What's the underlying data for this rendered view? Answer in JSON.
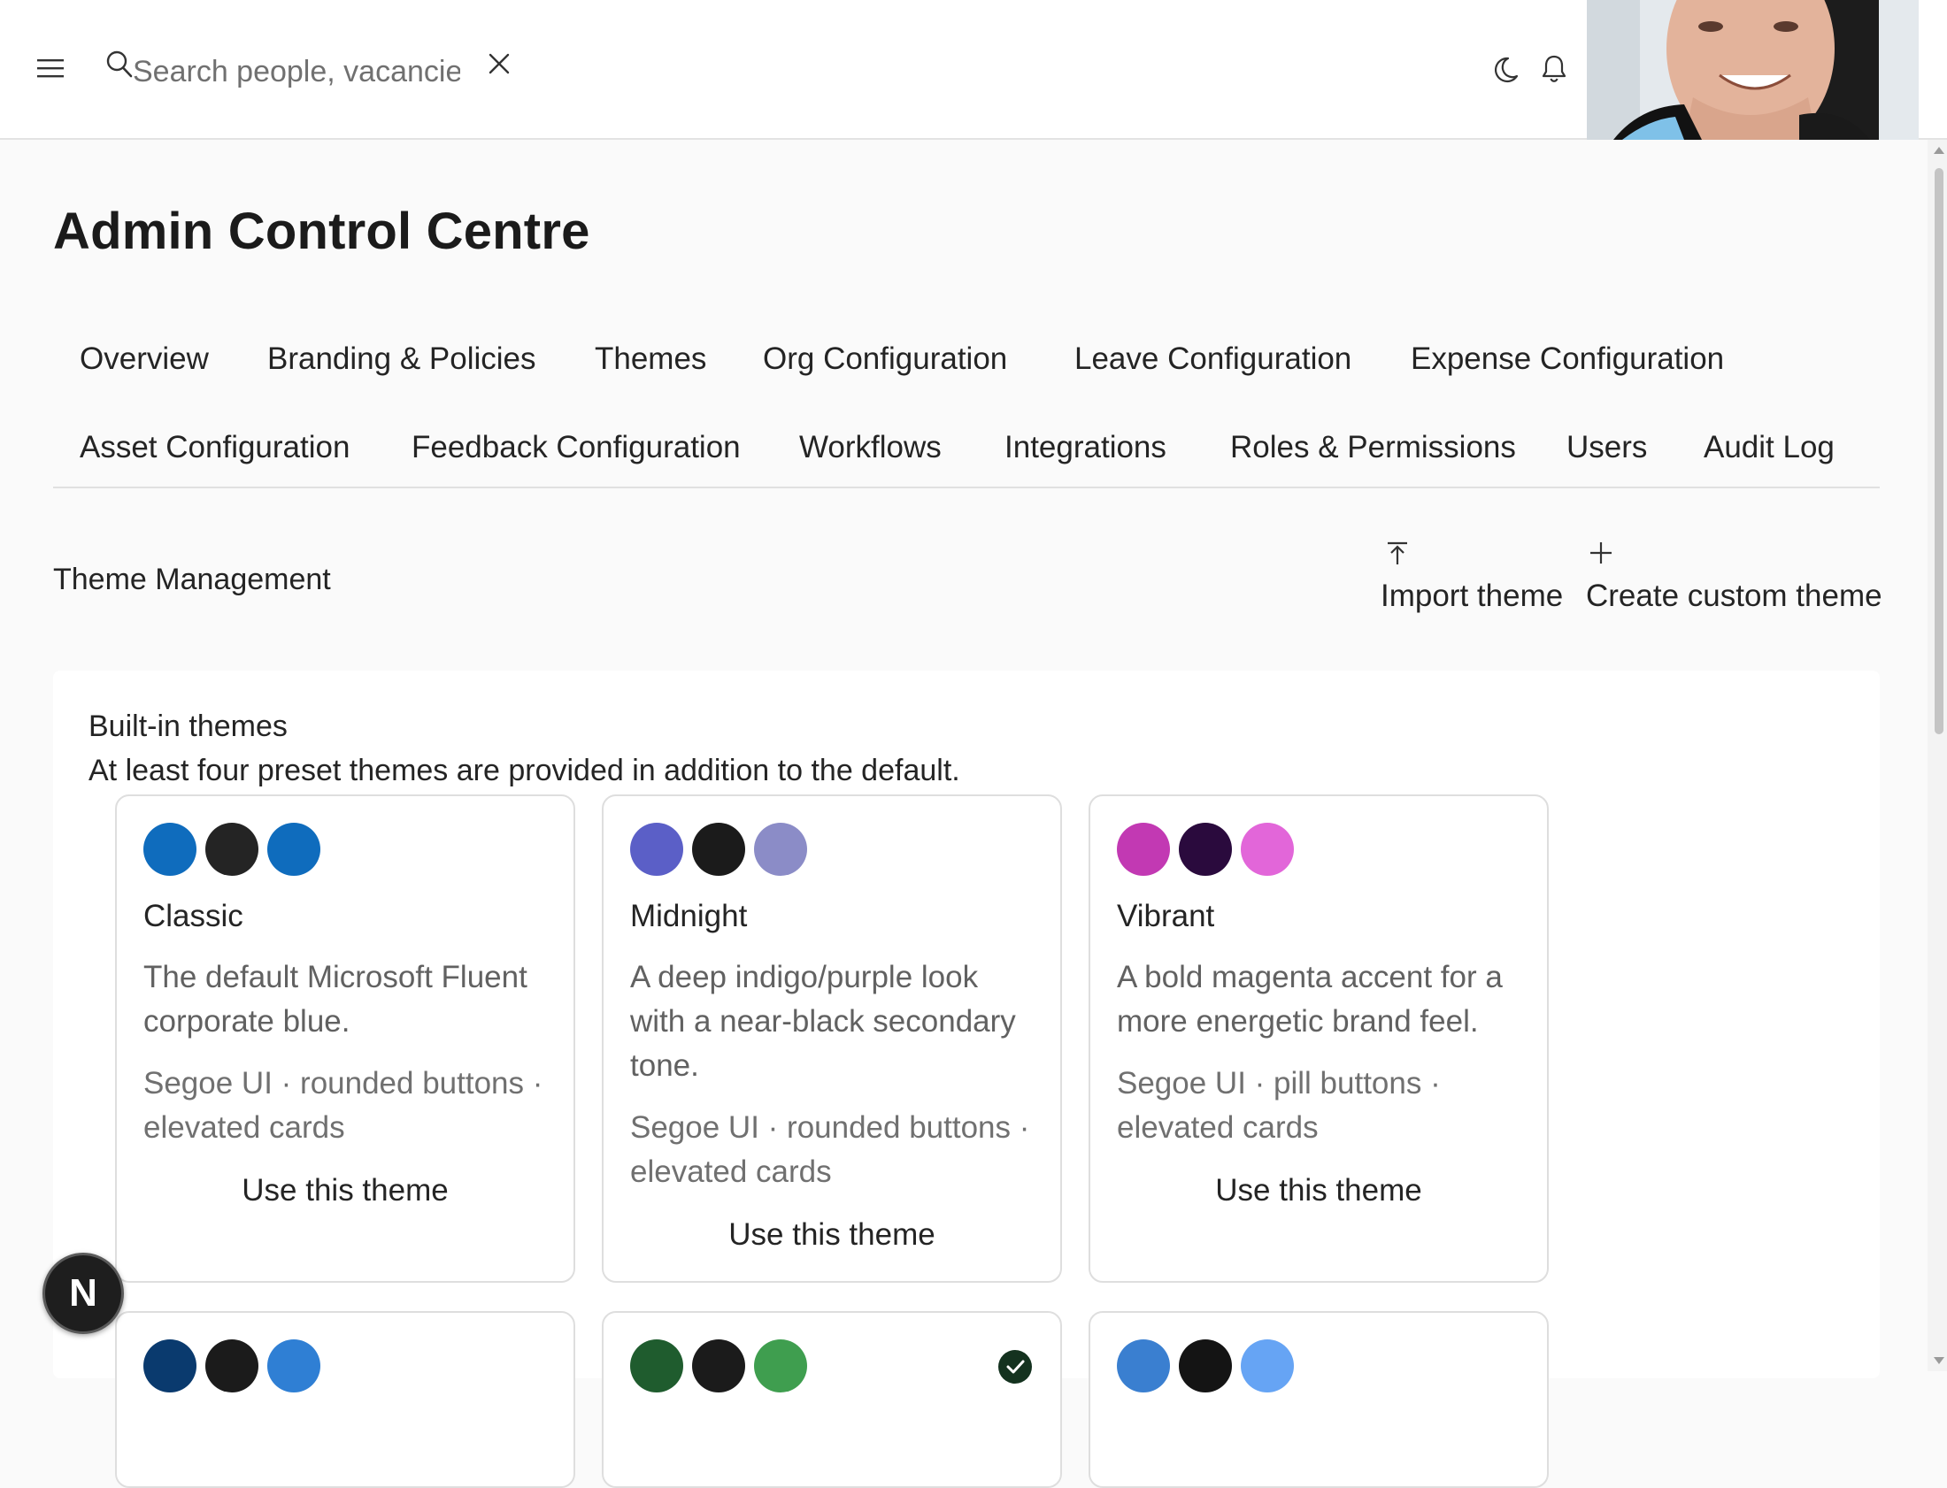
{
  "header": {
    "search": {
      "placeholder": "Search people, vacancies",
      "value": ""
    },
    "icons": [
      "hamburger-menu-icon",
      "search-icon",
      "close-icon",
      "moon-icon",
      "bell-icon"
    ]
  },
  "page": {
    "title": "Admin Control Centre"
  },
  "tabs": [
    {
      "label": "Overview"
    },
    {
      "label": "Branding & Policies"
    },
    {
      "label": "Themes"
    },
    {
      "label": "Org Configuration"
    },
    {
      "label": "Leave Configuration"
    },
    {
      "label": "Expense Configuration"
    },
    {
      "label": "Asset Configuration"
    },
    {
      "label": "Feedback Configuration"
    },
    {
      "label": "Workflows"
    },
    {
      "label": "Integrations"
    },
    {
      "label": "Roles & Permissions"
    },
    {
      "label": "Users"
    },
    {
      "label": "Audit Log"
    }
  ],
  "section": {
    "title": "Theme Management",
    "import_label": "Import theme",
    "create_label": "Create custom theme"
  },
  "builtin": {
    "title": "Built-in themes",
    "subtitle": "At least four preset themes are provided in addition to the default.",
    "themes": [
      {
        "name": "Classic",
        "description": "The default Microsoft Fluent corporate blue.",
        "meta": "Segoe UI · rounded buttons · elevated cards",
        "button": "Use this theme",
        "swatches": [
          "#0f6cbd",
          "#242424",
          "#0f6cbd"
        ]
      },
      {
        "name": "Midnight",
        "description": "A deep indigo/purple look with a near-black secondary tone.",
        "meta": "Segoe UI · rounded buttons · elevated cards",
        "button": "Use this theme",
        "swatches": [
          "#5b5fc7",
          "#1b1b1b",
          "#8b8cc7"
        ]
      },
      {
        "name": "Vibrant",
        "description": "A bold magenta accent for a more energetic brand feel.",
        "meta": "Segoe UI · pill buttons · elevated cards",
        "button": "Use this theme",
        "swatches": [
          "#c239b3",
          "#2a0a3d",
          "#e266d9"
        ]
      },
      {
        "swatches": [
          "#0a3a6e",
          "#1b1b1b",
          "#2f7fd4"
        ]
      },
      {
        "swatches": [
          "#1f5c2e",
          "#1b1b1b",
          "#3f9e4f"
        ],
        "selected": true
      },
      {
        "swatches": [
          "#3a7fd0",
          "#141414",
          "#66a4f4"
        ]
      }
    ]
  },
  "fab": {
    "letter": "N"
  }
}
